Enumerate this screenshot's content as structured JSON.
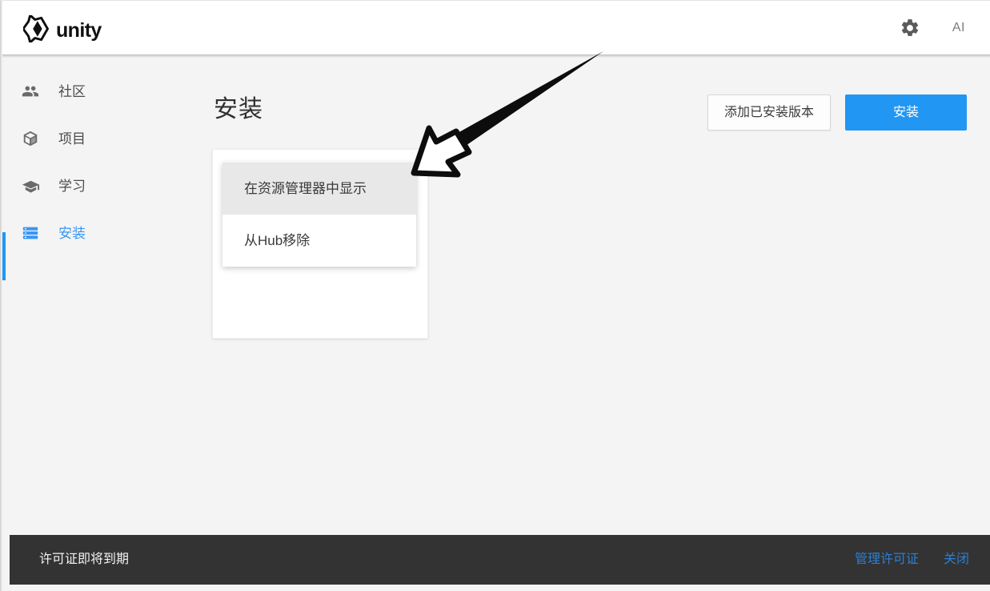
{
  "app": {
    "brand_word": "unity",
    "logo_icon": "unity-logo-icon"
  },
  "header": {
    "settings_icon": "gear-icon",
    "ai_label": "AI"
  },
  "sidebar": {
    "items": [
      {
        "label": "社区",
        "icon": "community-people-icon",
        "active": false
      },
      {
        "label": "项目",
        "icon": "project-cube-icon",
        "active": false
      },
      {
        "label": "学习",
        "icon": "learn-graduation-cap-icon",
        "active": false
      },
      {
        "label": "安装",
        "icon": "installs-list-icon",
        "active": true
      }
    ]
  },
  "main": {
    "title": "安装",
    "buttons": {
      "add_installed": "添加已安装版本",
      "install": "安装"
    },
    "context_menu": {
      "items": [
        {
          "label": "在资源管理器中显示",
          "highlighted": true
        },
        {
          "label": "从Hub移除",
          "highlighted": false
        }
      ]
    }
  },
  "notification": {
    "message": "许可证即将到期",
    "manage_label": "管理许可证",
    "close_label": "关闭"
  },
  "annotation": {
    "type": "arrow",
    "description": "hand-drawn-arrow-pointing-to-context-menu"
  },
  "colors": {
    "accent_blue": "#2196f3",
    "link_blue": "#2b7fd6",
    "page_bg": "#f4f4f4",
    "notification_bg": "#333333",
    "menu_highlight": "#e8e8e8"
  }
}
